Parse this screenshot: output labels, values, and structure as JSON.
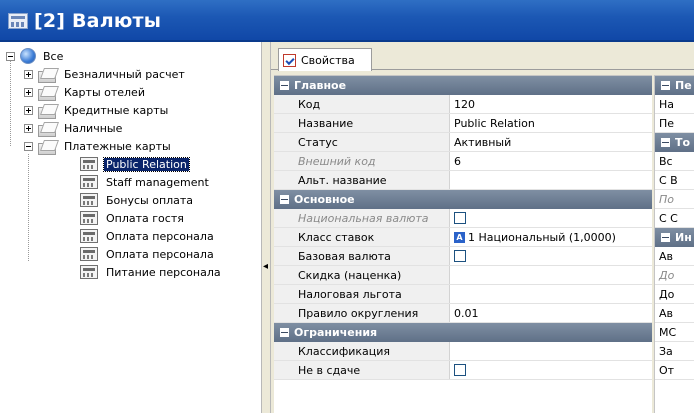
{
  "window": {
    "title": "[2] Валюты"
  },
  "tree": {
    "root": "Все",
    "groups": [
      {
        "label": "Безналичный расчет",
        "expanded": false
      },
      {
        "label": "Карты отелей",
        "expanded": false
      },
      {
        "label": "Кредитные карты",
        "expanded": false
      },
      {
        "label": "Наличные",
        "expanded": false
      },
      {
        "label": "Платежные карты",
        "expanded": true
      }
    ],
    "children": [
      "Public Relation",
      "Staff management",
      "Бонусы оплата",
      "Оплата гостя",
      "Оплата персонала",
      "Оплата персонала",
      "Питание персонала"
    ],
    "selected": "Public Relation"
  },
  "tabs": [
    {
      "label": "Свойства"
    }
  ],
  "props": {
    "sections": [
      {
        "title": "Главное",
        "rows": [
          {
            "name": "Код",
            "value": "120"
          },
          {
            "name": "Название",
            "value": "Public Relation"
          },
          {
            "name": "Статус",
            "value": "Активный"
          },
          {
            "name": "Внешний код",
            "value": "6",
            "dim": true
          },
          {
            "name": "Альт. название",
            "value": ""
          }
        ]
      },
      {
        "title": "Основное",
        "rows": [
          {
            "name": "Национальная валюта",
            "checkbox": false,
            "dim": true
          },
          {
            "name": "Класс ставок",
            "value": "1 Национальный (1,0000)",
            "badge": "A"
          },
          {
            "name": "Базовая валюта",
            "checkbox": false
          },
          {
            "name": "Скидка (наценка)",
            "value": ""
          },
          {
            "name": "Налоговая льгота",
            "value": ""
          },
          {
            "name": "Правило округления",
            "value": "0.01"
          }
        ]
      },
      {
        "title": "Ограничения",
        "rows": [
          {
            "name": "Классификация",
            "value": ""
          },
          {
            "name": "Не в сдаче",
            "checkbox": false
          }
        ]
      }
    ]
  },
  "side_grid": {
    "rows": [
      {
        "sec": true,
        "text": "Пе"
      },
      {
        "text": "На"
      },
      {
        "text": "Пе"
      },
      {
        "sec": true,
        "text": "То"
      },
      {
        "text": "Вс"
      },
      {
        "text": "С В"
      },
      {
        "text": "По",
        "dim": true
      },
      {
        "text": "С С"
      },
      {
        "sec": true,
        "text": "Ин"
      },
      {
        "text": "Ав"
      },
      {
        "text": "До",
        "dim": true
      },
      {
        "text": "До"
      },
      {
        "text": "Ав"
      },
      {
        "text": "МС"
      },
      {
        "text": "За"
      },
      {
        "text": "От"
      }
    ]
  }
}
